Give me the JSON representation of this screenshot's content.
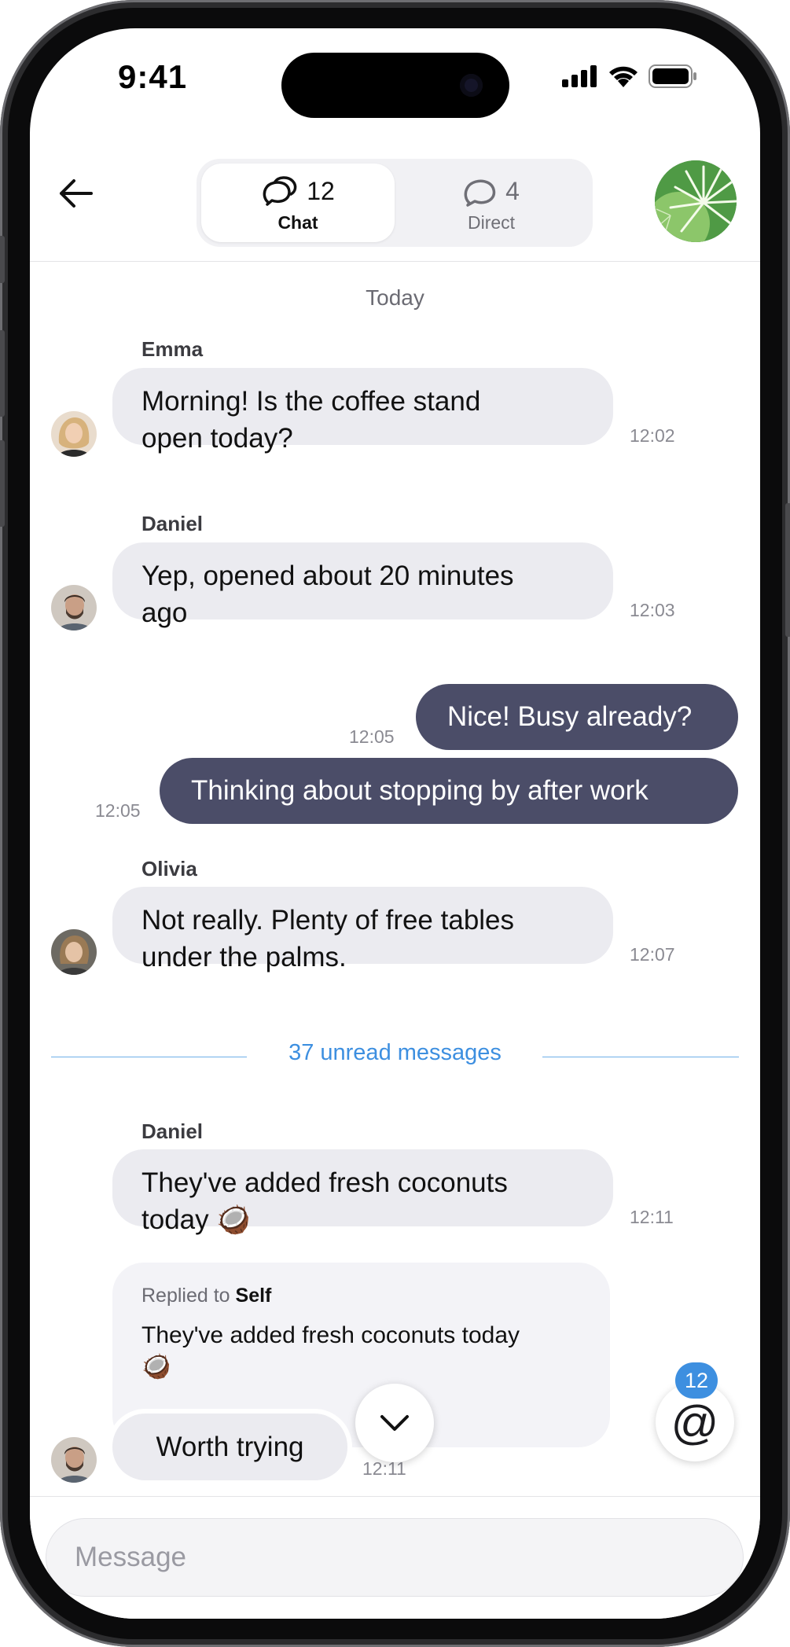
{
  "status_bar": {
    "time": "9:41"
  },
  "header": {
    "tabs": [
      {
        "label": "Chat",
        "count": "12",
        "active": true,
        "icon": "chat-bubbles-icon"
      },
      {
        "label": "Direct",
        "count": "4",
        "active": false,
        "icon": "chat-bubble-icon"
      }
    ],
    "group_avatar": "palm-leaves-avatar"
  },
  "chat": {
    "day_label": "Today",
    "messages": [
      {
        "sender": "Emma",
        "line1": "Morning! Is the coffee stand",
        "line2": "open today?",
        "time": "12:02"
      },
      {
        "sender": "Daniel",
        "line1": "Yep, opened about 20 minutes",
        "line2": "ago",
        "time": "12:03"
      },
      {
        "text": "Nice! Busy already?",
        "time": "12:05",
        "outgoing": true
      },
      {
        "text": "Thinking about stopping by after work",
        "time": "12:05",
        "outgoing": true
      },
      {
        "sender": "Olivia",
        "line1": "Not really. Plenty of free tables",
        "line2": "under the palms.",
        "time": "12:07"
      }
    ],
    "unread_label": "37 unread messages",
    "after_unread": {
      "sender": "Daniel",
      "line1": "They've added fresh coconuts",
      "line2": "today 🥥",
      "time": "12:11",
      "reply": {
        "prefix": "Replied to",
        "target": "Self",
        "quote_line1": "They've added fresh coconuts today",
        "quote_line2": "🥥"
      },
      "followup": "Worth trying",
      "followup_time": "12:11"
    },
    "mention_badge": "12",
    "mention_symbol": "@"
  },
  "composer": {
    "placeholder": "Message"
  },
  "colors": {
    "accent": "#3d8fe0",
    "outgoing_bubble": "#4b4d68",
    "incoming_bubble": "#ebebf0"
  }
}
